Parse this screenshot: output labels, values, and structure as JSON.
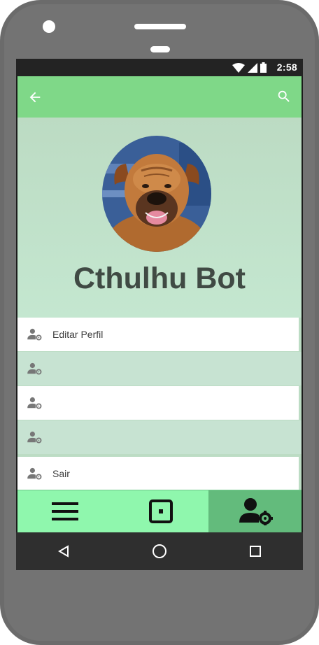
{
  "status": {
    "time": "2:58"
  },
  "appbar": {
    "back_icon": "arrow-left-icon",
    "search_icon": "search-icon"
  },
  "profile": {
    "name": "Cthulhu Bot"
  },
  "menu": [
    {
      "label": "Editar Perfil",
      "icon": "user-settings-icon"
    },
    {
      "label": "",
      "icon": "user-settings-icon"
    },
    {
      "label": "",
      "icon": "user-settings-icon"
    },
    {
      "label": "",
      "icon": "user-settings-icon"
    },
    {
      "label": "Sair",
      "icon": "user-settings-icon"
    }
  ],
  "bottom_nav": {
    "active": "profile"
  },
  "colors": {
    "appbar": "#7fd888",
    "background": "#bcdcc4",
    "bottom_nav": "#8ff7ad",
    "bottom_nav_active": "#63bb7c",
    "text_dark": "#404a44"
  }
}
